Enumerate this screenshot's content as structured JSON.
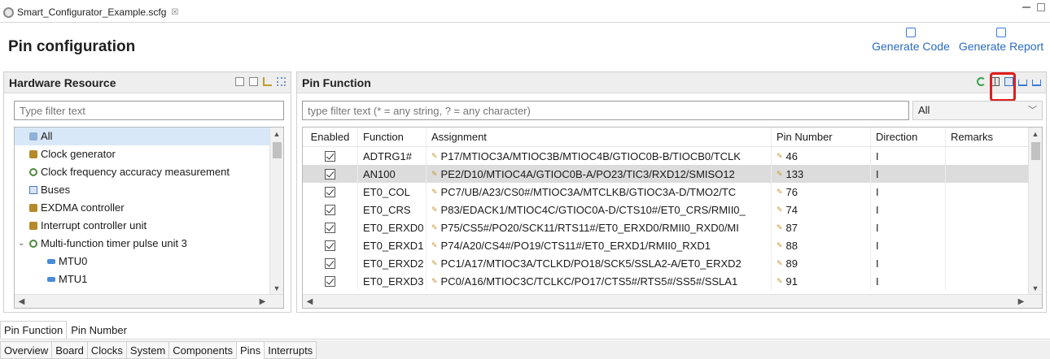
{
  "file_tab": {
    "label": "Smart_Configurator_Example.scfg",
    "close_glyph": "☒"
  },
  "page_title": "Pin configuration",
  "actions": {
    "generate_code": "Generate Code",
    "generate_report": "Generate Report"
  },
  "hardware_panel": {
    "title": "Hardware Resource",
    "filter_placeholder": "Type filter text",
    "items": [
      {
        "label": "All",
        "icon": "all-icon",
        "level": 0,
        "selected": true
      },
      {
        "label": "Clock generator",
        "icon": "chip-icon",
        "level": 0
      },
      {
        "label": "Clock frequency accuracy measurement",
        "icon": "gear-icon",
        "level": 0
      },
      {
        "label": "Buses",
        "icon": "bus-icon",
        "level": 0
      },
      {
        "label": "EXDMA controller",
        "icon": "chip-icon",
        "level": 0
      },
      {
        "label": "Interrupt controller unit",
        "icon": "chip-icon",
        "level": 0
      },
      {
        "label": "Multi-function timer pulse unit 3",
        "icon": "gear-icon",
        "level": 0,
        "expanded": true
      },
      {
        "label": "MTU0",
        "icon": "mtu-icon",
        "level": 1
      },
      {
        "label": "MTU1",
        "icon": "mtu-icon",
        "level": 1
      }
    ]
  },
  "pin_function_panel": {
    "title": "Pin Function",
    "filter_placeholder": "type filter text (* = any string, ? = any character)",
    "filter_select": "All",
    "columns": [
      "Enabled",
      "Function",
      "Assignment",
      "Pin Number",
      "Direction",
      "Remarks"
    ],
    "rows": [
      {
        "enabled": true,
        "function": "ADTRG1#",
        "assignment": "P17/MTIOC3A/MTIOC3B/MTIOC4B/GTIOC0B-B/TIOCB0/TCLK",
        "pin": "46",
        "direction": "I",
        "remarks": ""
      },
      {
        "enabled": true,
        "function": "AN100",
        "assignment": "PE2/D10/MTIOC4A/GTIOC0B-A/PO23/TIC3/RXD12/SMISO12",
        "pin": "133",
        "direction": "I",
        "remarks": "",
        "selected": true
      },
      {
        "enabled": true,
        "function": "ET0_COL",
        "assignment": "PC7/UB/A23/CS0#/MTIOC3A/MTCLKB/GTIOC3A-D/TMO2/TC",
        "pin": "76",
        "direction": "I",
        "remarks": ""
      },
      {
        "enabled": true,
        "function": "ET0_CRS",
        "assignment": "P83/EDACK1/MTIOC4C/GTIOC0A-D/CTS10#/ET0_CRS/RMII0_",
        "pin": "74",
        "direction": "I",
        "remarks": ""
      },
      {
        "enabled": true,
        "function": "ET0_ERXD0",
        "assignment": "P75/CS5#/PO20/SCK11/RTS11#/ET0_ERXD0/RMII0_RXD0/MI",
        "pin": "87",
        "direction": "I",
        "remarks": ""
      },
      {
        "enabled": true,
        "function": "ET0_ERXD1",
        "assignment": "P74/A20/CS4#/PO19/CTS11#/ET0_ERXD1/RMII0_RXD1",
        "pin": "88",
        "direction": "I",
        "remarks": ""
      },
      {
        "enabled": true,
        "function": "ET0_ERXD2",
        "assignment": "PC1/A17/MTIOC3A/TCLKD/PO18/SCK5/SSLA2-A/ET0_ERXD2",
        "pin": "89",
        "direction": "I",
        "remarks": ""
      },
      {
        "enabled": true,
        "function": "ET0_ERXD3",
        "assignment": "PC0/A16/MTIOC3C/TCLKC/PO17/CTS5#/RTS5#/SS5#/SSLA1",
        "pin": "91",
        "direction": "I",
        "remarks": ""
      }
    ]
  },
  "view_tabs": [
    "Pin Function",
    "Pin Number"
  ],
  "view_tabs_active": 0,
  "editor_tabs": [
    "Overview",
    "Board",
    "Clocks",
    "System",
    "Components",
    "Pins",
    "Interrupts"
  ],
  "editor_tabs_active": 5
}
